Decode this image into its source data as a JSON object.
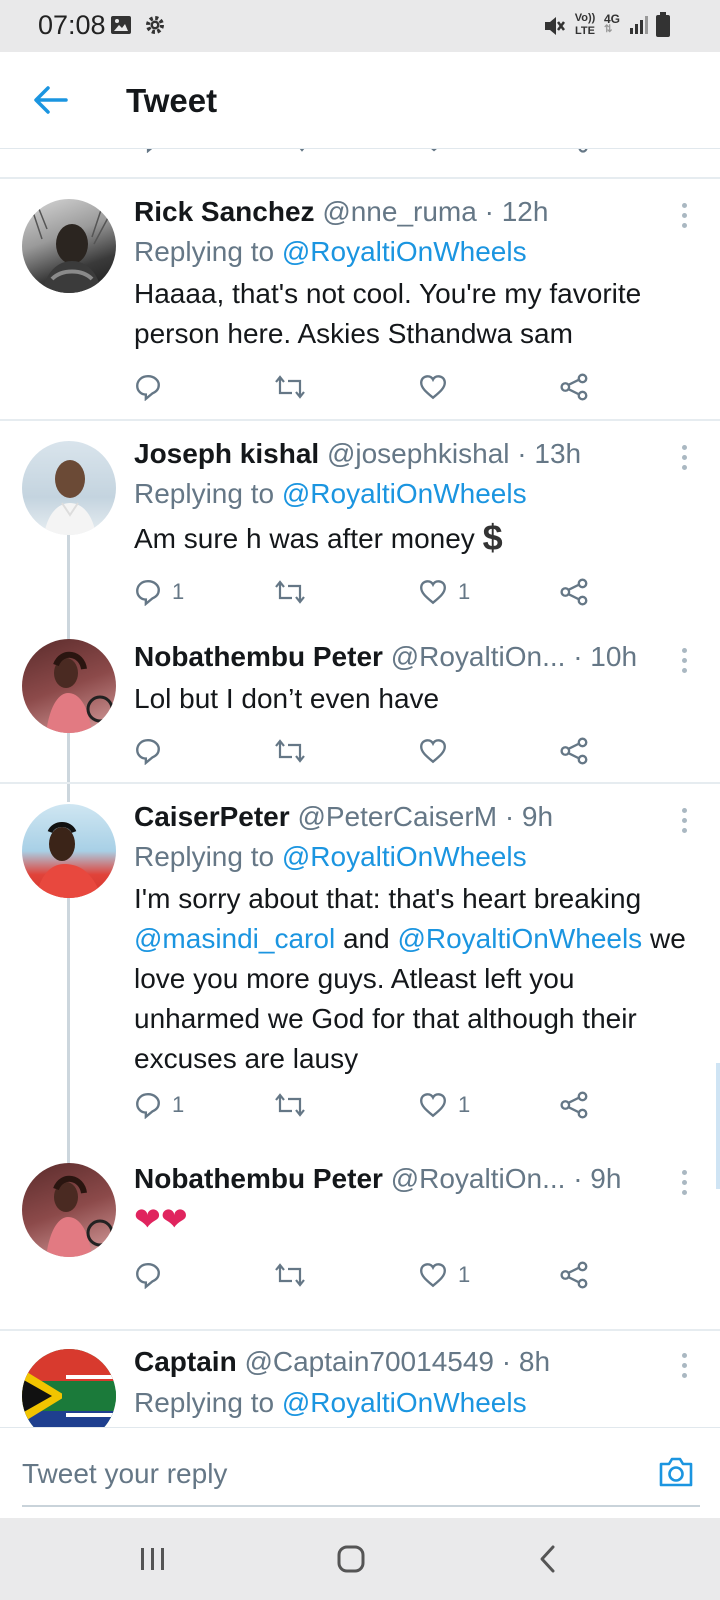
{
  "status_bar": {
    "time": "07:08",
    "icons": [
      "image-icon",
      "gear-icon",
      "mute-icon",
      "volte-icon",
      "4g-icon",
      "signal-icon",
      "battery-icon"
    ],
    "volte_label": "Vo)) LTE",
    "network_label": "4G"
  },
  "header": {
    "title": "Tweet",
    "back_icon": "arrow-left-icon"
  },
  "tweets": [
    {
      "name": "Rick Sanchez",
      "handle": "@nne_ruma",
      "time": "· 12h",
      "replying_prefix": "Replying to",
      "replying_to": "@RoyaltiOnWheels",
      "text": "Haaaa, that's not cool. You're my favorite person here. Askies Sthandwa sam",
      "replies": "",
      "likes": ""
    },
    {
      "name": "Joseph kishal",
      "handle": "@josephkishal",
      "time": "· 13h",
      "replying_prefix": "Replying to",
      "replying_to": "@RoyaltiOnWheels",
      "text": "Am sure h was after money",
      "emoji": "$",
      "replies": "1",
      "likes": "1"
    },
    {
      "name": "Nobathembu Peter",
      "handle": "@RoyaltiOn...",
      "time": "· 10h",
      "text": "Lol but I don’t even have",
      "replies": "",
      "likes": ""
    },
    {
      "name": "CaiserPeter",
      "handle": "@PeterCaiserM",
      "time": "· 9h",
      "replying_prefix": "Replying to",
      "replying_to": "@RoyaltiOnWheels",
      "text_line1": "I'm sorry about that: that's heart breaking",
      "mention1": "@masindi_carol",
      "and_word": "and",
      "mention2": "@RoyaltiOnWheels",
      "text_rest": "we love you more guys. Atleast left you unharmed we God for that although their excuses are lausy",
      "replies": "1",
      "likes": "1"
    },
    {
      "name": "Nobathembu Peter",
      "handle": "@RoyaltiOn...",
      "time": "· 9h",
      "text": "❤❤",
      "replies": "",
      "likes": "1"
    },
    {
      "name": "Captain",
      "handle": "@Captain70014549",
      "time": "· 8h",
      "replying_prefix": "Replying to",
      "replying_to": "@RoyaltiOnWheels"
    }
  ],
  "composer": {
    "placeholder": "Tweet your reply",
    "camera_icon": "camera-icon"
  },
  "nav_bar": {
    "icons": [
      "recent-apps-icon",
      "home-icon",
      "back-icon"
    ]
  },
  "colors": {
    "accent": "#1b95e0",
    "secondary_text": "#657786",
    "primary_text": "#14171a",
    "heart": "#e0245e"
  }
}
